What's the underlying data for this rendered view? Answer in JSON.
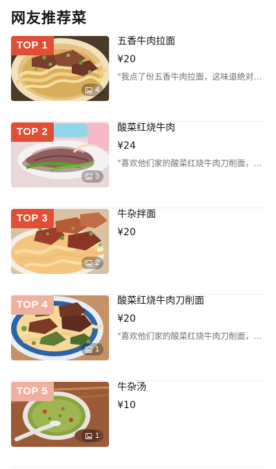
{
  "page": {
    "title": "网友推荐菜"
  },
  "items": [
    {
      "rank": "TOP 1",
      "name": "五香牛肉拉面",
      "price": "¥20",
      "review": "\"我点了份五香牛肉拉面，这味道绝对好吃\"",
      "photo_count": "4",
      "rank_color": "#e24d35",
      "image_name": "food-photo-spiced-beef-noodles"
    },
    {
      "rank": "TOP 2",
      "name": "酸菜红烧牛肉",
      "price": "¥24",
      "review": "\"喜欢他们家的酸菜红烧牛肉刀削面，好...",
      "photo_count": "3",
      "rank_color": "#e24d35",
      "image_name": "food-photo-braised-beef"
    },
    {
      "rank": "TOP 3",
      "name": "牛杂拌面",
      "price": "¥20",
      "review": "",
      "photo_count": "2",
      "rank_color": "#e24d35",
      "image_name": "food-photo-beef-offal-noodles"
    },
    {
      "rank": "TOP 4",
      "name": "酸菜红烧牛肉刀削面",
      "price": "¥20",
      "review": "\"喜欢他们家的酸菜红烧牛肉刀削面，好...",
      "photo_count": "1",
      "rank_color": "#efb19f",
      "image_name": "food-photo-sauerkraut-braised-beef-noodles"
    },
    {
      "rank": "TOP 5",
      "name": "牛杂汤",
      "price": "¥10",
      "review": "",
      "photo_count": "1",
      "rank_color": "#efb19f",
      "image_name": "food-photo-beef-offal-soup"
    }
  ],
  "icons": {
    "photo": "image-gallery-icon"
  }
}
